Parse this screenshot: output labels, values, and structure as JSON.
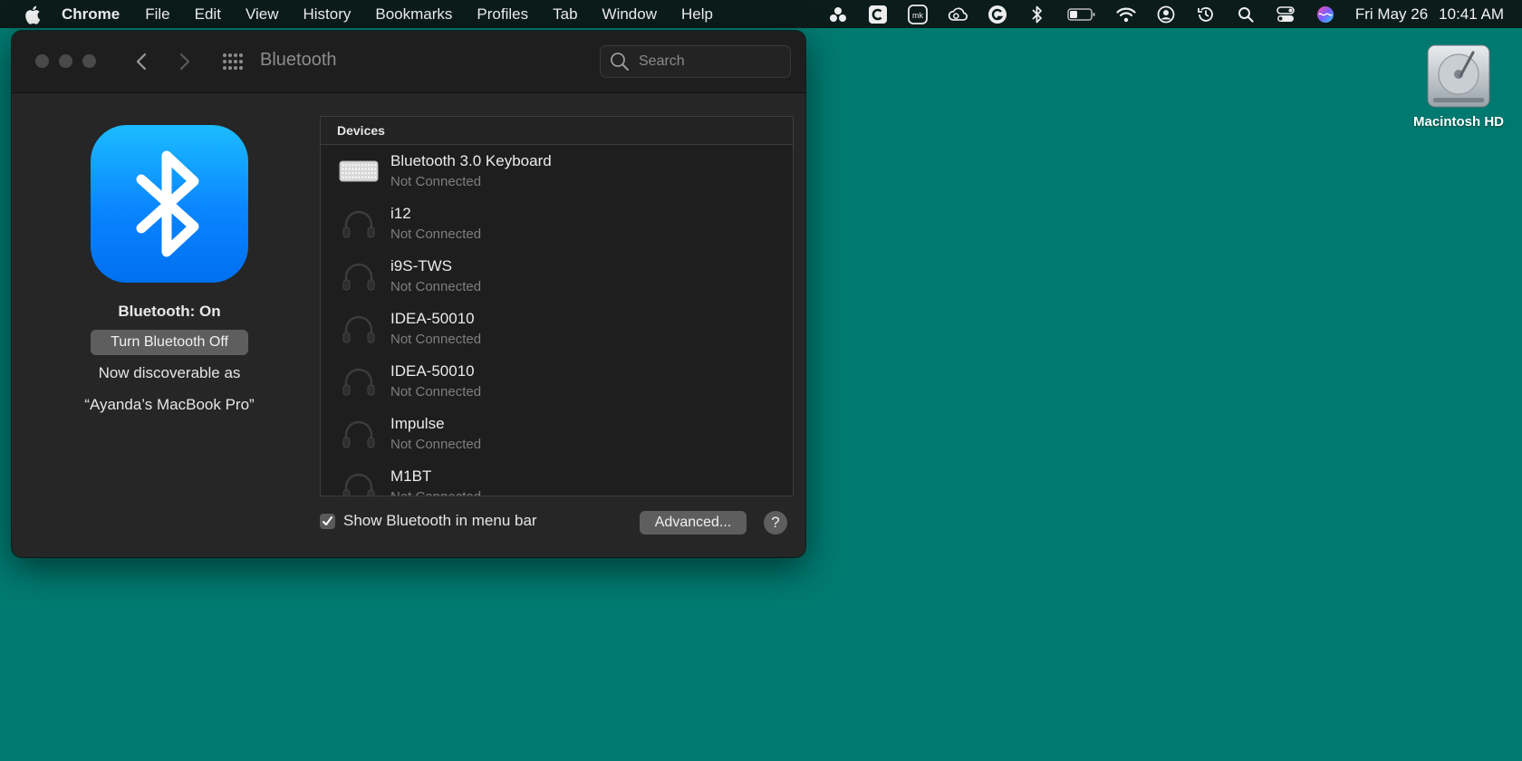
{
  "menubar": {
    "app_name": "Chrome",
    "items": [
      "File",
      "Edit",
      "View",
      "History",
      "Bookmarks",
      "Profiles",
      "Tab",
      "Window",
      "Help"
    ],
    "date": "Fri May 26",
    "time": "10:41 AM",
    "status_icons": [
      "dots-cluster-icon",
      "c-app-icon",
      "mk-app-icon",
      "creative-cloud-icon",
      "grammarly-icon",
      "bluetooth-icon",
      "battery-icon",
      "wifi-icon",
      "user-icon",
      "time-machine-icon",
      "spotlight-search-icon",
      "control-center-icon",
      "siri-icon"
    ]
  },
  "desktop": {
    "icon_label": "Macintosh HD"
  },
  "window": {
    "title": "Bluetooth",
    "search_placeholder": "Search",
    "bluetooth_status": "Bluetooth: On",
    "toggle_label": "Turn Bluetooth Off",
    "discoverable_label": "Now discoverable as",
    "discoverable_name": "“Ayanda’s MacBook Pro”",
    "devices_header": "Devices",
    "devices": [
      {
        "name": "Bluetooth 3.0 Keyboard",
        "status": "Not Connected",
        "icon": "keyboard-icon"
      },
      {
        "name": "i12",
        "status": "Not Connected",
        "icon": "headphones-icon"
      },
      {
        "name": "i9S-TWS",
        "status": "Not Connected",
        "icon": "headphones-icon"
      },
      {
        "name": "IDEA-50010",
        "status": "Not Connected",
        "icon": "headphones-icon"
      },
      {
        "name": "IDEA-50010",
        "status": "Not Connected",
        "icon": "headphones-icon"
      },
      {
        "name": "Impulse",
        "status": "Not Connected",
        "icon": "headphones-icon"
      },
      {
        "name": "M1BT",
        "status": "Not Connected",
        "icon": "headphones-icon"
      }
    ],
    "show_in_menubar_label": "Show Bluetooth in menu bar",
    "show_in_menubar_checked": true,
    "advanced_label": "Advanced...",
    "help_label": "?"
  }
}
